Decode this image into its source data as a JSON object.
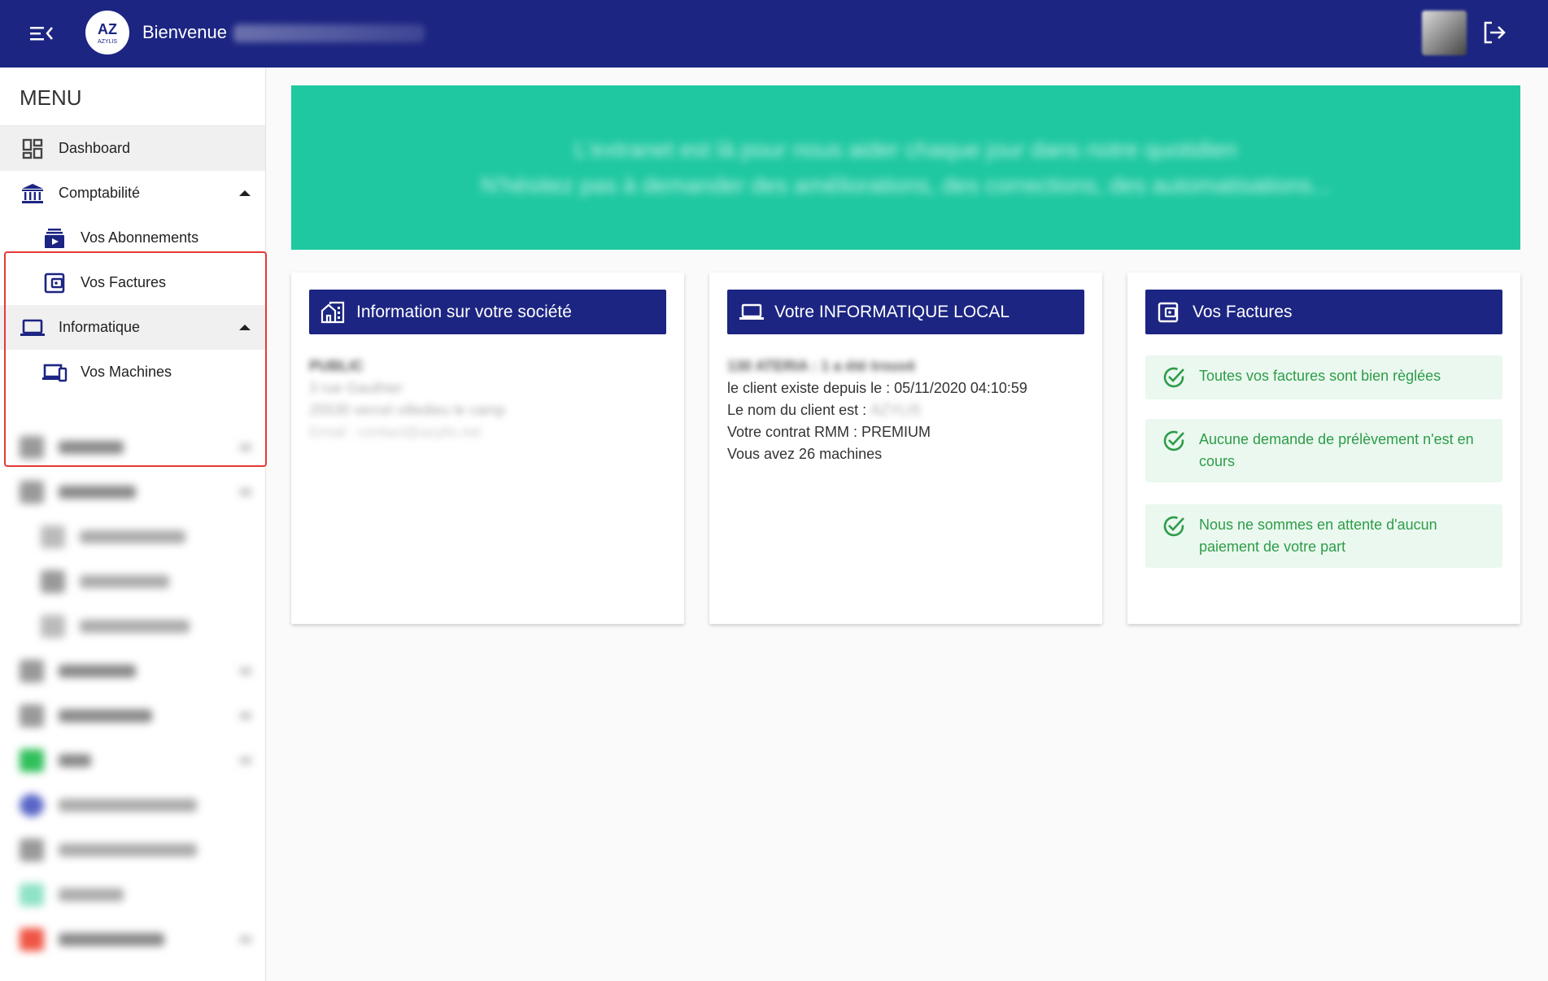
{
  "header": {
    "welcome_label": "Bienvenue",
    "user_name": "Christophe",
    "logo_text_top": "AZ",
    "logo_text_bottom": "AZYLIS"
  },
  "sidebar": {
    "title": "MENU",
    "items": [
      {
        "label": "Dashboard",
        "icon": "dashboard-icon"
      },
      {
        "label": "Comptabilité",
        "icon": "bank-icon"
      },
      {
        "label": "Vos Abonnements",
        "icon": "subscriptions-icon"
      },
      {
        "label": "Vos Factures",
        "icon": "wallet-icon"
      },
      {
        "label": "Informatique",
        "icon": "laptop-icon"
      },
      {
        "label": "Vos Machines",
        "icon": "devices-icon"
      }
    ]
  },
  "banner": {
    "line1": "L'extranet est là pour nous aider chaque jour dans notre quotidien",
    "line2": "N'hésitez pas à demander des améliorations, des corrections, des automatisations..."
  },
  "cards": {
    "company": {
      "title": "Information sur votre société",
      "name": "PUBLIC",
      "address": "3 rue Gauthier",
      "city": "25530 vercel villedieu le camp",
      "email": "Email : contact@azylis.net"
    },
    "it": {
      "title": "Votre INFORMATIQUE LOCAL",
      "ateria": "130 ATERIA : 1 a été trouvé",
      "since": "le client existe depuis le : 05/11/2020 04:10:59",
      "client_name_label": "Le nom du client est :",
      "client_name_value": "AZYLIS",
      "contract": "Votre contrat RMM : PREMIUM",
      "machines": "Vous avez 26 machines"
    },
    "invoices": {
      "title": "Vos Factures",
      "statuses": [
        "Toutes vos factures sont bien règlées",
        "Aucune demande de prélèvement n'est en cours",
        "Nous ne sommes en attente d'aucun paiement de votre part"
      ]
    }
  },
  "colors": {
    "primary": "#1c2582",
    "banner": "#1fc8a1",
    "success_text": "#2e9c48",
    "success_bg": "#eaf8ef",
    "highlight": "#e53935"
  }
}
